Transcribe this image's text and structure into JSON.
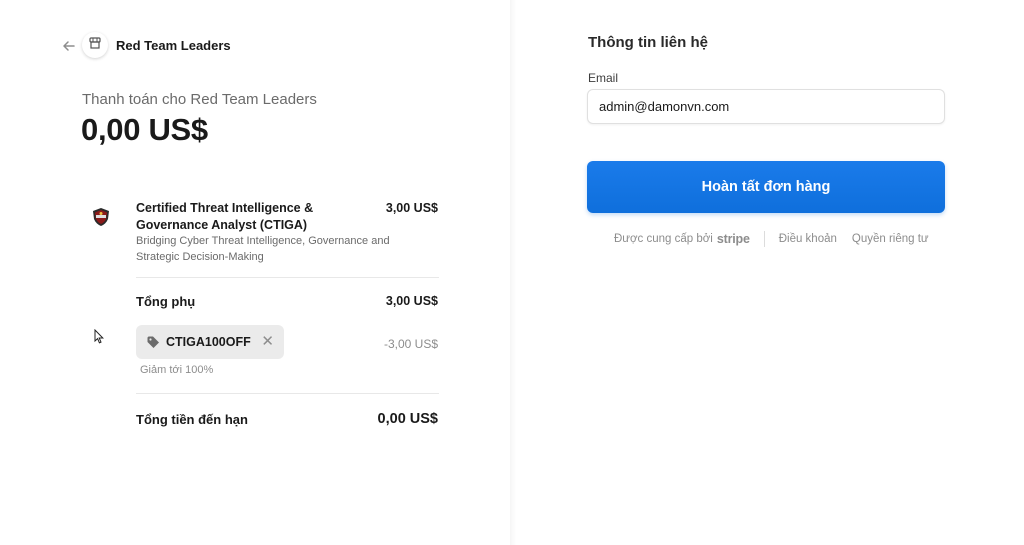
{
  "store": {
    "name": "Red Team Leaders",
    "pay_to_text": "Thanh toán cho Red Team Leaders",
    "total_amount": "0,00 US$"
  },
  "product": {
    "name": "Certified Threat Intelligence & Governance Analyst (CTIGA)",
    "price": "3,00 US$",
    "description": "Bridging Cyber Threat Intelligence, Governance and Strategic Decision-Making"
  },
  "summary": {
    "subtotal_label": "Tổng phụ",
    "subtotal_value": "3,00 US$",
    "promo_code": "CTIGA100OFF",
    "discount_value": "-3,00 US$",
    "discount_note": "Giảm tới 100%",
    "due_label": "Tổng tiền đến hạn",
    "due_value": "0,00 US$"
  },
  "contact": {
    "title": "Thông tin liên hệ",
    "email_label": "Email",
    "email_value": "admin@damonvn.com",
    "submit_label": "Hoàn tất đơn hàng"
  },
  "footer": {
    "powered_by": "Được cung cấp bởi",
    "stripe": "stripe",
    "terms": "Điều khoản",
    "privacy": "Quyền riêng tư"
  },
  "colors": {
    "accent": "#0f6fdc",
    "text": "#1a1a1a",
    "muted": "#6b6b6b"
  },
  "icons": [
    "back-arrow-icon",
    "store-icon",
    "product-logo-icon",
    "tag-icon",
    "close-icon",
    "cursor-icon"
  ]
}
